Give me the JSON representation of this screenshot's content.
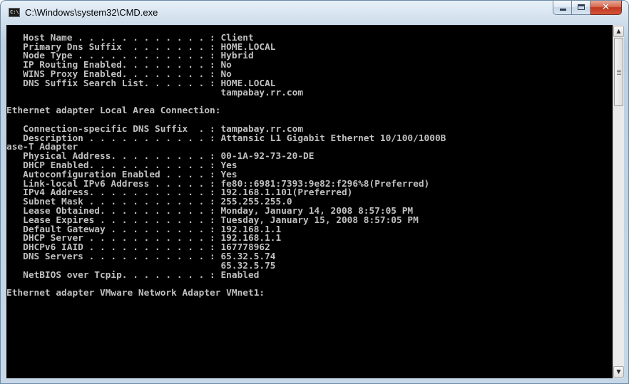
{
  "window": {
    "title": "C:\\Windows\\system32\\CMD.exe",
    "icon": "cmd-icon",
    "icon_text": "C:\\",
    "minimize_glyph": "",
    "close_glyph": "✕"
  },
  "console": {
    "lines": [
      "",
      "   Host Name . . . . . . . . . . . . : Client",
      "   Primary Dns Suffix  . . . . . . . : HOME.LOCAL",
      "   Node Type . . . . . . . . . . . . : Hybrid",
      "   IP Routing Enabled. . . . . . . . : No",
      "   WINS Proxy Enabled. . . . . . . . : No",
      "   DNS Suffix Search List. . . . . . : HOME.LOCAL",
      "                                       tampabay.rr.com",
      "",
      "Ethernet adapter Local Area Connection:",
      "",
      "   Connection-specific DNS Suffix  . : tampabay.rr.com",
      "   Description . . . . . . . . . . . : Attansic L1 Gigabit Ethernet 10/100/1000B",
      "ase-T Adapter",
      "   Physical Address. . . . . . . . . : 00-1A-92-73-20-DE",
      "   DHCP Enabled. . . . . . . . . . . : Yes",
      "   Autoconfiguration Enabled . . . . : Yes",
      "   Link-local IPv6 Address . . . . . : fe80::6981:7393:9e82:f296%8(Preferred)",
      "   IPv4 Address. . . . . . . . . . . : 192.168.1.101(Preferred)",
      "   Subnet Mask . . . . . . . . . . . : 255.255.255.0",
      "   Lease Obtained. . . . . . . . . . : Monday, January 14, 2008 8:57:05 PM",
      "   Lease Expires . . . . . . . . . . : Tuesday, January 15, 2008 8:57:05 PM",
      "   Default Gateway . . . . . . . . . : 192.168.1.1",
      "   DHCP Server . . . . . . . . . . . : 192.168.1.1",
      "   DHCPv6 IAID . . . . . . . . . . . : 167778962",
      "   DNS Servers . . . . . . . . . . . : 65.32.5.74",
      "                                       65.32.5.75",
      "   NetBIOS over Tcpip. . . . . . . . : Enabled",
      "",
      "Ethernet adapter VMware Network Adapter VMnet1:",
      "",
      ""
    ]
  },
  "colors": {
    "console_bg": "#000000",
    "console_text": "#c0c0c0",
    "close_button": "#c74a33"
  },
  "scrollbar": {
    "up_arrow": "▲",
    "down_arrow": "▼"
  }
}
